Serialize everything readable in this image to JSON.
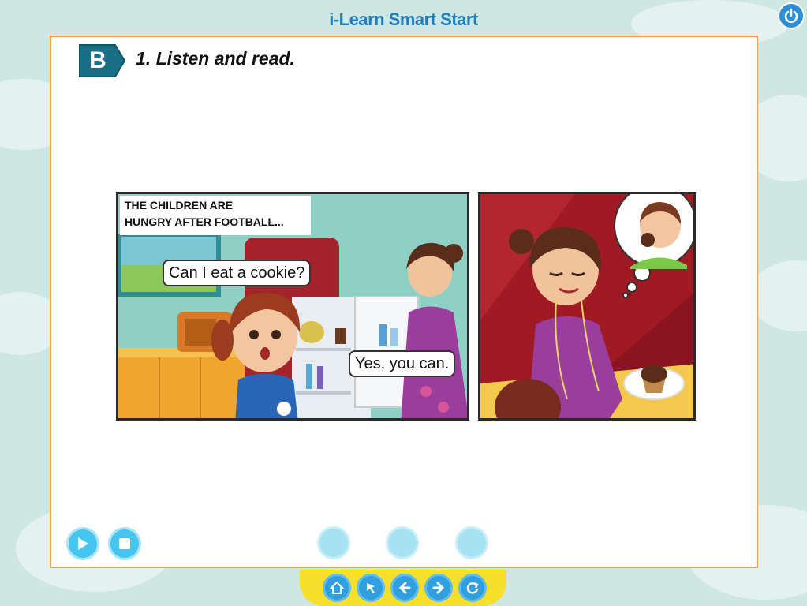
{
  "app": {
    "title": "i-Learn Smart Start"
  },
  "lesson": {
    "section_letter": "B",
    "instruction": "1. Listen and read."
  },
  "comic": {
    "panel1": {
      "caption_line1": "THE CHILDREN ARE",
      "caption_line2": "HUNGRY AFTER FOOTBALL...",
      "speech_child": "Can I eat a cookie?",
      "speech_mom": "Yes, you can."
    }
  },
  "controls": {
    "play_icon": "play-icon",
    "stop_icon": "stop-icon",
    "page_dots": 3
  },
  "nav": {
    "icons": [
      "home-icon",
      "cursor-icon",
      "back-icon",
      "next-icon",
      "refresh-icon"
    ]
  },
  "colors": {
    "accent_blue": "#1f7fbe",
    "panel_border": "#f0a24a",
    "nav_bar": "#f7df2c",
    "badge_teal": "#1a6f86"
  }
}
